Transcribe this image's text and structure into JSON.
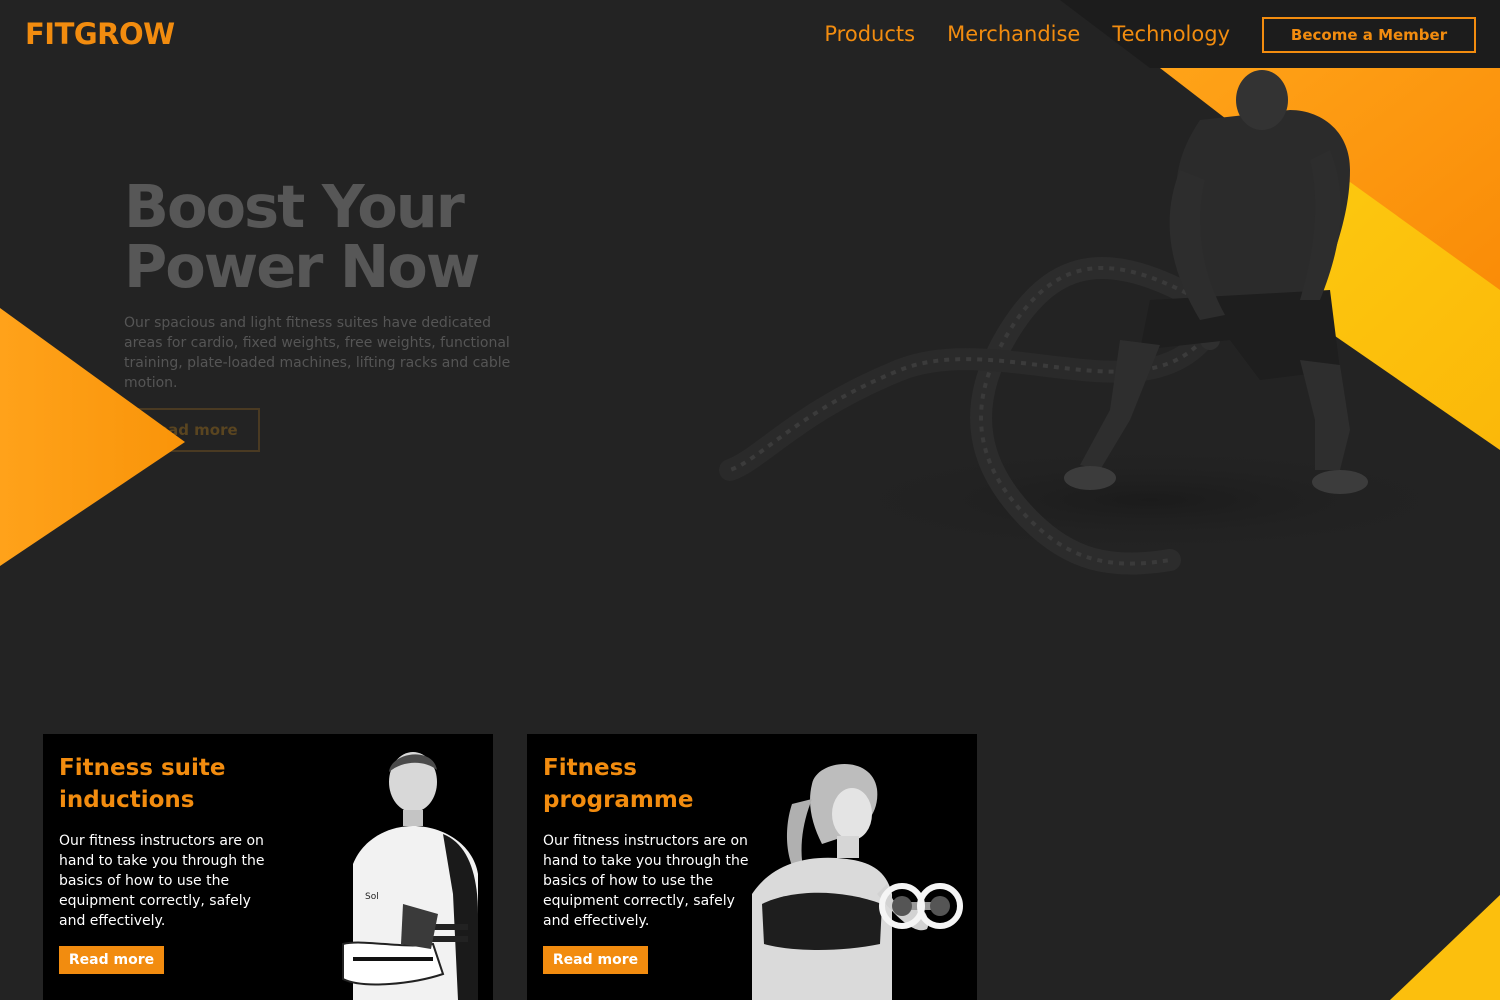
{
  "brand": {
    "logo": "FITGROW"
  },
  "nav": {
    "items": [
      "Products",
      "Merchandise",
      "Technology"
    ],
    "cta": "Become a Member"
  },
  "hero": {
    "title_line1": "Boost Your",
    "title_line2": "Power Now",
    "description": "Our spacious and light fitness suites have dedicated areas for cardio, fixed weights, free weights, functional training, plate-loaded machines, lifting racks and cable motion.",
    "button": "Read more"
  },
  "cards": [
    {
      "title": "Fitness suite inductions",
      "text": "Our fitness instructors are on hand to take you through the basics of how to use the equipment correctly, safely and effectively.",
      "button": "Read more"
    },
    {
      "title": "Fitness programme",
      "text": "Our fitness instructors are on hand to take you through the basics of how to use the equipment correctly, safely and effectively.",
      "button": "Read more"
    }
  ],
  "colors": {
    "accent": "#f28c0f",
    "accent_yellow": "#fcbf0d",
    "background": "#232323",
    "card": "#000000"
  },
  "icons": {
    "hero_image": "battle-rope-athlete-photo",
    "card1_image": "man-holding-sneakers-photo",
    "card2_image": "woman-lifting-dumbbell-photo"
  }
}
